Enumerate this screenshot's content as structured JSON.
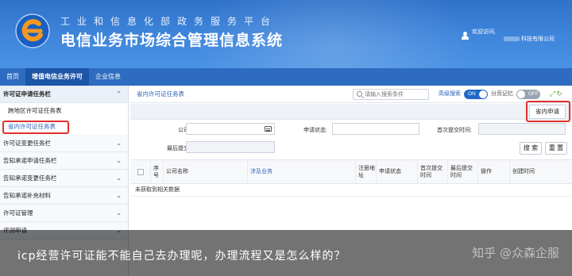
{
  "header": {
    "subtitle": "工业和信息化部政务服务平台",
    "title": "电信业务市场综合管理信息系统",
    "welcome": "欢迎访问,",
    "company": "科技有限公司"
  },
  "nav": {
    "items": [
      {
        "label": "首页",
        "active": false
      },
      {
        "label": "增值电信业务许可",
        "active": true
      },
      {
        "label": "企业信息",
        "active": false
      }
    ]
  },
  "sidebar": {
    "group1": "许可证申请任务栏",
    "sub1": "跨地区许可证任务表",
    "sub2": "省内许可证任务表",
    "group2": "许可证变更任务栏",
    "group3": "告知承诺申请任务栏",
    "group4": "告知承诺变更任务栏",
    "group5": "告知承诺补充材料",
    "group6": "许可证管理",
    "group7": "评测申请"
  },
  "toolbar": {
    "page_label": "省内许可证任务表",
    "search_placeholder": "请输入搜索条件",
    "advanced_search": "高级搜索",
    "toggle_on": "ON",
    "page_memory": "分页记忆",
    "toggle_off": "OFF"
  },
  "actions": {
    "apply_label": "省内申请"
  },
  "form": {
    "company_label": "公司名称:",
    "status_label": "申请状态:",
    "first_submit_label": "首次提交时间:",
    "last_submit_label": "最后提交时间:",
    "search_btn": "搜 索",
    "reset_btn": "重 置"
  },
  "table": {
    "headers": {
      "seq": "序号",
      "company": "公司名称",
      "business": "涉及业务",
      "reg_address": "注册地址",
      "status": "申请状态",
      "first_submit": "首次提交时间",
      "last_submit": "最后提交时间",
      "operation": "操作",
      "created": "创建时间"
    },
    "empty_text": "未获取到相关数据"
  },
  "caption": {
    "text": "icp经营许可证能不能自己去办理呢，办理流程又是怎么样的？",
    "watermark": "知乎 @众森企服"
  },
  "colors": {
    "header_blue": "#3f86dc",
    "nav_blue": "#2d6cc0",
    "highlight_red": "#e0302c",
    "link_blue": "#2a62b8"
  }
}
